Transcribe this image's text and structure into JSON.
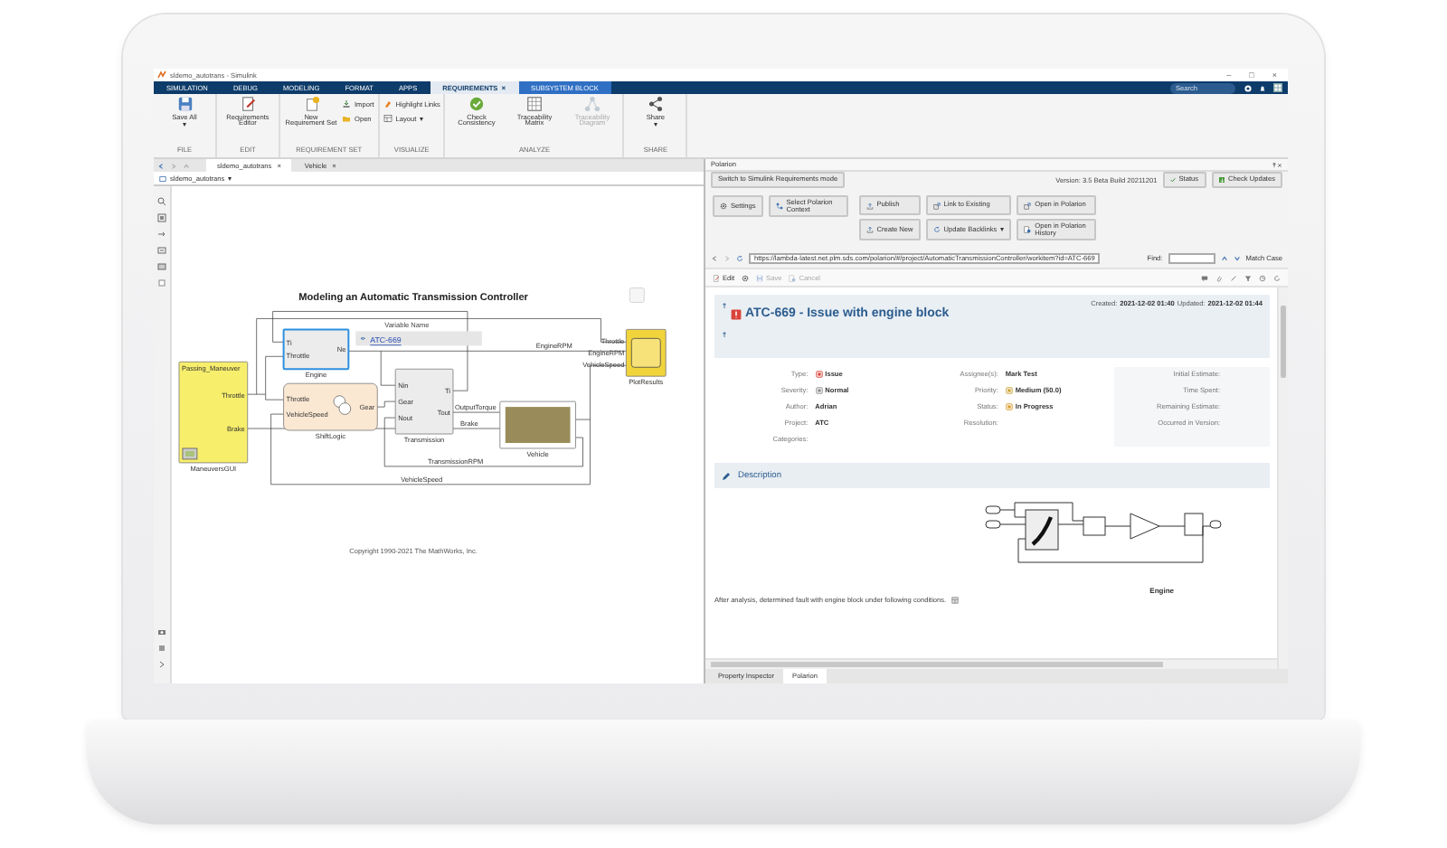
{
  "window": {
    "title": "sldemo_autotrans - Simulink",
    "controls": [
      "–",
      "□",
      "×"
    ]
  },
  "ribbon_tabs": [
    {
      "label": "SIMULATION",
      "selected": false,
      "contextual": false
    },
    {
      "label": "DEBUG",
      "selected": false,
      "contextual": false
    },
    {
      "label": "MODELING",
      "selected": false,
      "contextual": false
    },
    {
      "label": "FORMAT",
      "selected": false,
      "contextual": false
    },
    {
      "label": "APPS",
      "selected": false,
      "contextual": false
    },
    {
      "label": "REQUIREMENTS",
      "selected": true,
      "contextual": false,
      "close": "×"
    },
    {
      "label": "SUBSYSTEM BLOCK",
      "selected": false,
      "contextual": true
    }
  ],
  "search": {
    "placeholder": "Search"
  },
  "ribbon_groups": [
    {
      "label": "FILE",
      "buttons": [
        {
          "kind": "large",
          "label": "Save All",
          "caret": "▾",
          "disabled": false
        }
      ]
    },
    {
      "label": "EDIT",
      "buttons": [
        {
          "kind": "large",
          "label": "Requirements Editor",
          "disabled": false
        }
      ]
    },
    {
      "label": "REQUIREMENT SET",
      "buttons": [
        {
          "kind": "large",
          "label": "New Requirement Set",
          "disabled": false
        },
        {
          "kind": "small",
          "label": "Import",
          "disabled": false
        },
        {
          "kind": "small",
          "label": "Open",
          "disabled": false
        }
      ]
    },
    {
      "label": "VISUALIZE",
      "buttons": [
        {
          "kind": "small",
          "label": "Highlight Links",
          "disabled": false
        },
        {
          "kind": "small",
          "label": "Layout",
          "caret": "▾",
          "disabled": false
        }
      ]
    },
    {
      "label": "ANALYZE",
      "buttons": [
        {
          "kind": "large",
          "label": "Check Consistency",
          "disabled": false
        },
        {
          "kind": "large",
          "label": "Traceability Matrix",
          "disabled": false
        },
        {
          "kind": "large",
          "label": "Traceability Diagram",
          "disabled": true
        }
      ]
    },
    {
      "label": "SHARE",
      "buttons": [
        {
          "kind": "large",
          "label": "Share",
          "caret": "▾",
          "disabled": false
        }
      ]
    }
  ],
  "editor": {
    "doc_tabs": [
      {
        "label": "sldemo_autotrans",
        "selected": true,
        "close": "×"
      },
      {
        "label": "Vehicle",
        "selected": false,
        "close": "×"
      }
    ],
    "breadcrumb": {
      "label": "sldemo_autotrans",
      "caret": "▾"
    },
    "diagram": {
      "title": "Modeling an Automatic Transmission Controller",
      "blocks": [
        {
          "kind": "gui",
          "name": "ManeuversGUI",
          "selected": false,
          "header": "Passing_Maneuver",
          "outputs": [
            "Throttle",
            "Brake"
          ]
        },
        {
          "kind": "subsystem",
          "name": "Engine",
          "selected": true,
          "inputs": [
            "Ti",
            "Throttle"
          ],
          "outputs": [
            "Ne"
          ]
        },
        {
          "kind": "chart",
          "name": "ShiftLogic",
          "selected": false,
          "inputs": [
            "Throttle",
            "VehicleSpeed"
          ],
          "outputs": [
            "Gear"
          ]
        },
        {
          "kind": "subsystem",
          "name": "Transmission",
          "selected": false,
          "inputs": [
            "Nin",
            "Gear",
            "Nout"
          ],
          "outputs": [
            "Ti",
            "Tout"
          ]
        },
        {
          "kind": "vehicle",
          "name": "Vehicle",
          "selected": false
        },
        {
          "kind": "scope",
          "name": "PlotResults",
          "selected": false,
          "inputs": [
            "Throttle",
            "EngineRPM",
            "VehicleSpeed"
          ]
        }
      ],
      "signals": [
        "EngineRPM",
        "OutputTorque",
        "Brake",
        "TransmissionRPM",
        "VehicleSpeed"
      ],
      "annotation": {
        "caption": "Variable Name",
        "link": "ATC-669"
      },
      "copyright": "Copyright 1990-2021 The MathWorks, Inc."
    }
  },
  "polarion": {
    "title": "Polarion",
    "mode_button": "Switch to Simulink Requirements mode",
    "version": "Version: 3.5 Beta Build 20211201",
    "status_button": "Status",
    "update_button": "Check Updates",
    "actions": [
      {
        "label": "Settings"
      },
      {
        "label": "Select Polarion Context"
      },
      {
        "label": "Publish"
      },
      {
        "label": "Link to Existing"
      },
      {
        "label": "Open in Polarion"
      },
      {
        "label": "Create New"
      },
      {
        "label": "Update Backlinks",
        "caret": "▾"
      },
      {
        "label": "Open in Polarion History"
      }
    ],
    "url": "https://lambda-latest.net.plm.sds.com/polarion/#/project/AutomaticTransmissionController/workitem?id=ATC-669",
    "find_label": "Find:",
    "match_case": "Match Case",
    "toolbar": [
      {
        "label": "Edit",
        "disabled": false
      },
      {
        "label": "Save",
        "disabled": true
      },
      {
        "label": "Cancel",
        "disabled": true
      }
    ],
    "item": {
      "title": "ATC-669 - Issue with engine block",
      "created_label": "Created:",
      "created": "2021-12-02 01:40",
      "updated_label": "Updated:",
      "updated": "2021-12-02 01:44",
      "field_columns": [
        {
          "fields": [
            {
              "label": "Type:",
              "value": "Issue"
            },
            {
              "label": "Severity:",
              "value": "Normal"
            },
            {
              "label": "Author:",
              "value": "Adrian"
            },
            {
              "label": "Project:",
              "value": "ATC"
            },
            {
              "label": "Categories:"
            }
          ]
        },
        {
          "fields": [
            {
              "label": "Assignee(s):",
              "value": "Mark Test"
            },
            {
              "label": "Priority:",
              "value": "Medium (50.0)"
            },
            {
              "label": "Status:",
              "value": "In Progress"
            },
            {
              "label": "Resolution:"
            }
          ]
        },
        {
          "fields": [
            {
              "label": "Initial Estimate:"
            },
            {
              "label": "Time Spent:"
            },
            {
              "label": "Remaining Estimate:"
            },
            {
              "label": "Occurred in Version:"
            }
          ]
        }
      ],
      "description_title": "Description",
      "figure_caption": "Engine",
      "text": "After analysis, determined fault with engine block under following conditions."
    },
    "bottom_tabs": [
      {
        "label": "Property Inspector",
        "selected": false
      },
      {
        "label": "Polarion",
        "selected": true
      }
    ]
  }
}
